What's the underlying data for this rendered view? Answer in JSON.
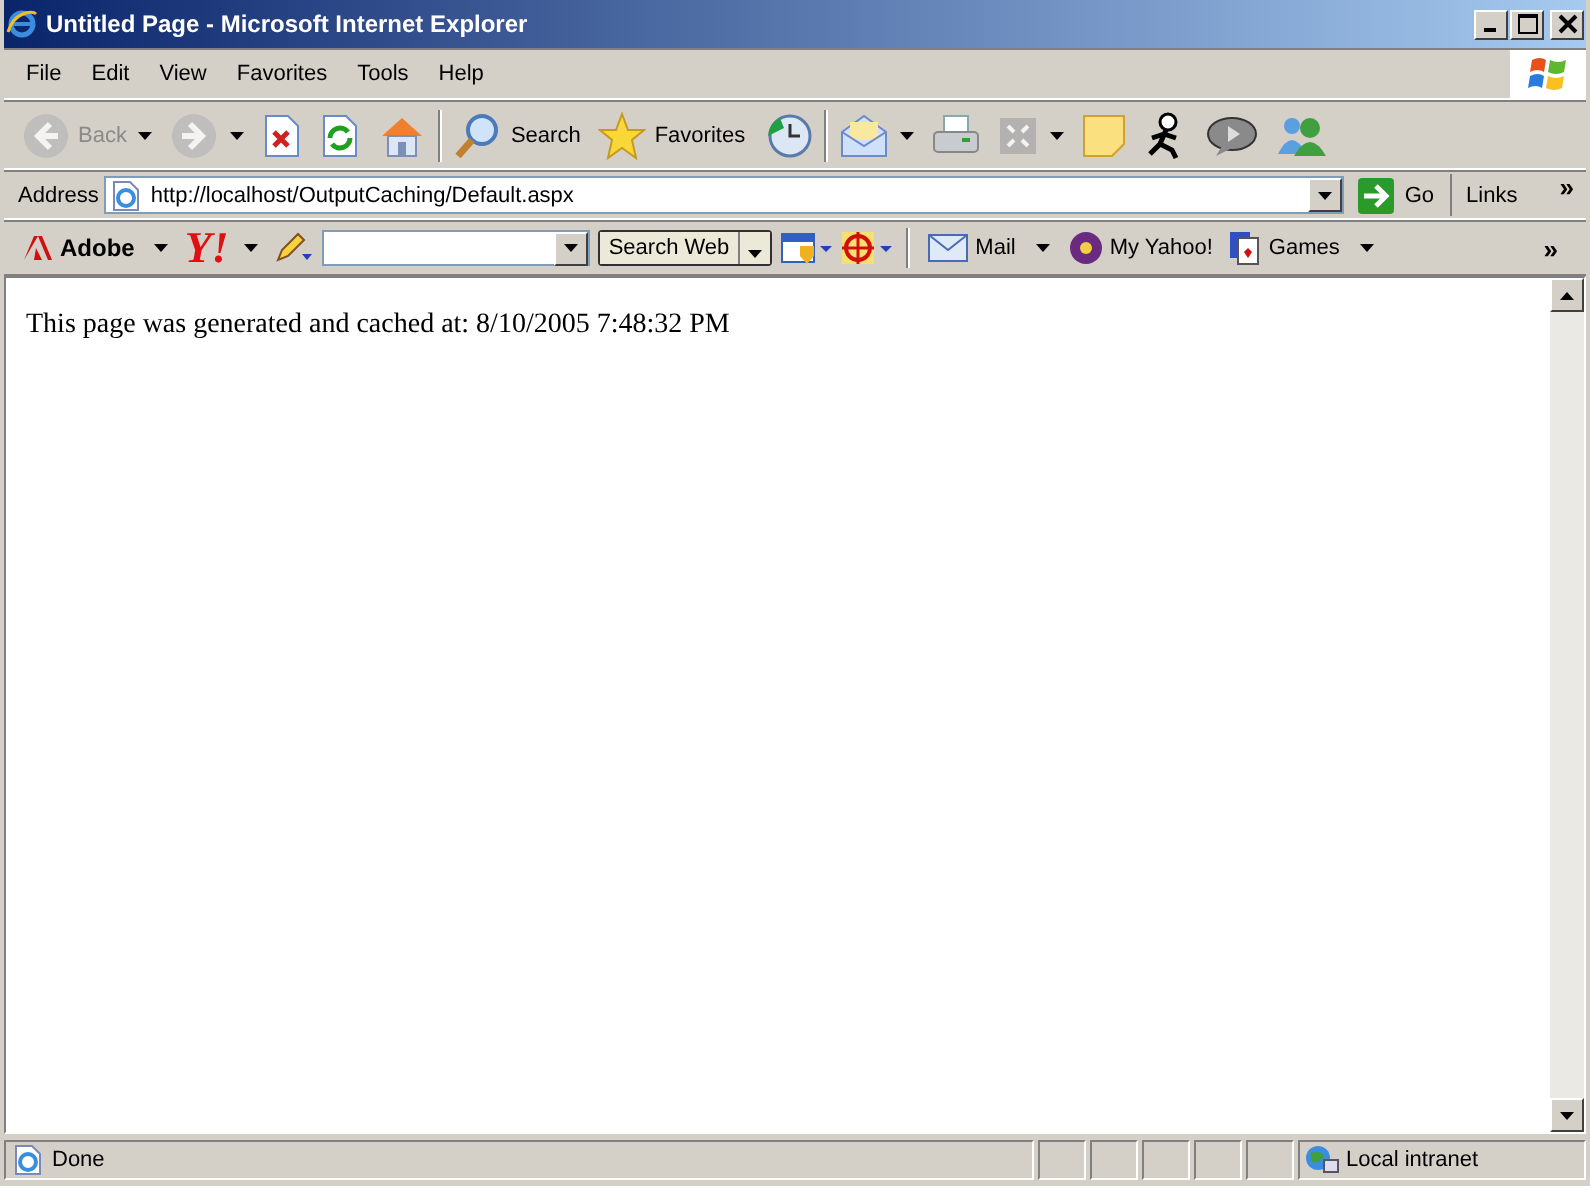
{
  "window": {
    "title": "Untitled Page - Microsoft Internet Explorer"
  },
  "menu": [
    "File",
    "Edit",
    "View",
    "Favorites",
    "Tools",
    "Help"
  ],
  "toolbar": [
    {
      "kind": "back",
      "label": "Back",
      "disabled": true,
      "dropdown": true
    },
    {
      "kind": "forward",
      "disabled": true,
      "dropdown": true
    },
    {
      "kind": "stop",
      "disabled": false,
      "dropdown": false
    },
    {
      "kind": "refresh",
      "disabled": false,
      "dropdown": false
    },
    {
      "kind": "home",
      "disabled": false,
      "dropdown": false
    },
    {
      "kind": "search",
      "label": "Search",
      "disabled": false,
      "dropdown": false
    },
    {
      "kind": "favorites",
      "label": "Favorites",
      "disabled": false,
      "dropdown": false
    },
    {
      "kind": "history",
      "disabled": false,
      "dropdown": false
    },
    {
      "kind": "mail",
      "disabled": false,
      "dropdown": true
    },
    {
      "kind": "print",
      "disabled": false,
      "dropdown": false
    },
    {
      "kind": "fullscreen",
      "disabled": true,
      "dropdown": true
    },
    {
      "kind": "note",
      "disabled": false,
      "dropdown": false
    },
    {
      "kind": "runner",
      "disabled": false,
      "dropdown": false
    },
    {
      "kind": "chat",
      "disabled": false,
      "dropdown": false
    },
    {
      "kind": "people",
      "disabled": false,
      "dropdown": false
    }
  ],
  "address": {
    "label": "Address",
    "value": "http://localhost/OutputCaching/Default.aspx",
    "go": "Go",
    "links": "Links",
    "more": "»"
  },
  "yahoo_toolbar": {
    "adobe": "Adobe",
    "yahoo": "Y!",
    "search_button": "Search Web",
    "mail": "Mail",
    "my_yahoo": "My Yahoo!",
    "games": "Games",
    "more": "»"
  },
  "content": {
    "text": "This page was generated and cached at: 8/10/2005 7:48:32 PM"
  },
  "status_bar": {
    "text": "Done",
    "zone": "Local intranet"
  }
}
